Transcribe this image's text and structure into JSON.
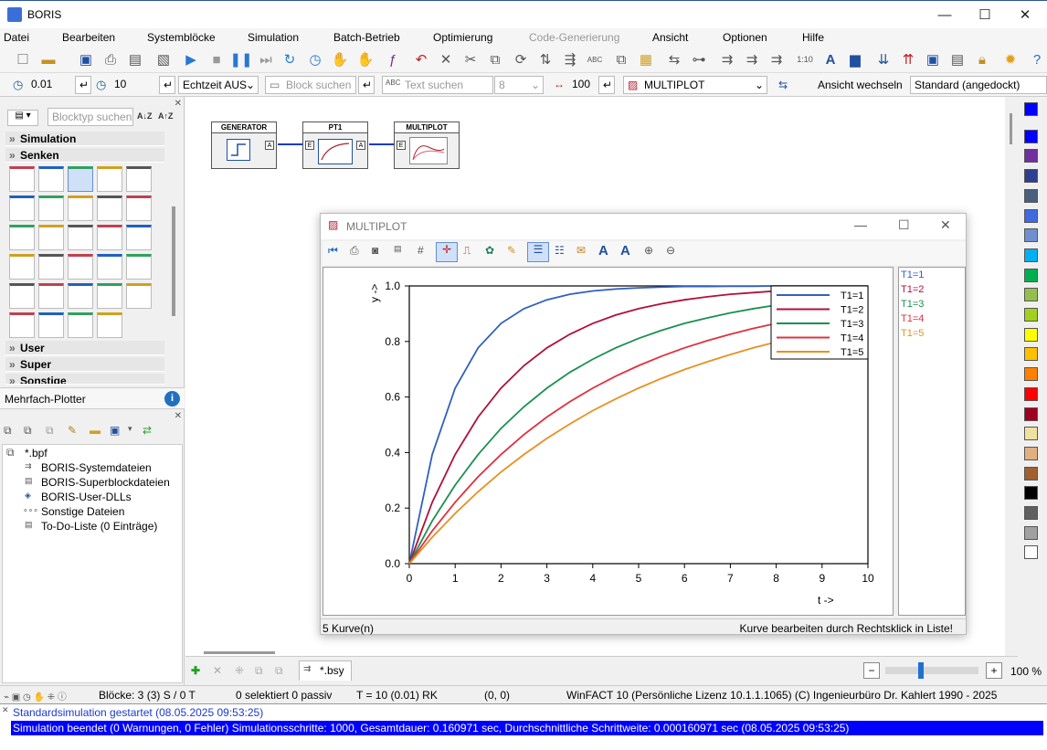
{
  "window": {
    "title": "BORIS",
    "minimize": "—",
    "maximize": "☐",
    "close": "✕"
  },
  "menu": [
    "Datei",
    "Bearbeiten",
    "Systemblöcke",
    "Simulation",
    "Batch-Betrieb",
    "Optimierung",
    "Code-Generierung",
    "Ansicht",
    "Optionen",
    "Hilfe"
  ],
  "toolbar2": {
    "step": "0.01",
    "end_time": "10",
    "realtime": "Echtzeit AUS",
    "block_search": "Block suchen",
    "text_search": "Text suchen",
    "font_size": "8",
    "zoom_val": "100",
    "target": "MULTIPLOT",
    "view_switch": "Ansicht wechseln",
    "layout": "Standard (angedockt)"
  },
  "left": {
    "search_placeholder": "Blocktyp suchen",
    "cats_top": [
      "Simulation",
      "Senken"
    ],
    "cats_bottom": [
      "User",
      "Super",
      "Sonstige"
    ],
    "selected_desc": "Mehrfach-Plotter",
    "tree_root": "*.bpf",
    "tree": [
      "BORIS-Systemdateien",
      "BORIS-Superblockdateien",
      "BORIS-User-DLLs",
      "Sonstige Dateien",
      "To-Do-Liste (0 Einträge)"
    ]
  },
  "diagram": {
    "blocks": [
      "GENERATOR",
      "PT1",
      "MULTIPLOT"
    ],
    "ports": {
      "out": "A",
      "in": "E"
    }
  },
  "plot": {
    "title": "MULTIPLOT",
    "status_left": "5 Kurve(n)",
    "status_right": "Kurve bearbeiten durch Rechtsklick in Liste!",
    "list": [
      "T1=1",
      "T1=2",
      "T1=3",
      "T1=4",
      "T1=5"
    ]
  },
  "chart_data": {
    "type": "line",
    "xlabel": "t ->",
    "ylabel": "y ->",
    "xlim": [
      0,
      10
    ],
    "ylim": [
      0,
      1
    ],
    "xticks": [
      "0",
      "1",
      "2",
      "3",
      "4",
      "5",
      "6",
      "7",
      "8",
      "9",
      "10"
    ],
    "yticks": [
      "0.0",
      "0.2",
      "0.4",
      "0.6",
      "0.8",
      "1.0"
    ],
    "x": [
      0,
      0.5,
      1,
      1.5,
      2,
      2.5,
      3,
      3.5,
      4,
      4.5,
      5,
      5.5,
      6,
      6.5,
      7,
      7.5,
      8,
      8.5,
      9,
      9.5,
      10
    ],
    "series": [
      {
        "name": "T1=1",
        "color": "#3060c0",
        "values": [
          0,
          0.393,
          0.632,
          0.777,
          0.865,
          0.918,
          0.95,
          0.97,
          0.982,
          0.989,
          0.993,
          0.996,
          0.998,
          0.998,
          0.999,
          0.999,
          1,
          1,
          1,
          1,
          1
        ]
      },
      {
        "name": "T1=2",
        "color": "#b0103a",
        "values": [
          0,
          0.221,
          0.393,
          0.528,
          0.632,
          0.713,
          0.777,
          0.826,
          0.865,
          0.895,
          0.918,
          0.936,
          0.95,
          0.961,
          0.97,
          0.976,
          0.982,
          0.986,
          0.989,
          0.991,
          0.993
        ]
      },
      {
        "name": "T1=3",
        "color": "#1a9050",
        "values": [
          0,
          0.154,
          0.283,
          0.393,
          0.487,
          0.565,
          0.632,
          0.689,
          0.736,
          0.777,
          0.811,
          0.84,
          0.865,
          0.885,
          0.903,
          0.918,
          0.931,
          0.941,
          0.95,
          0.958,
          0.964
        ]
      },
      {
        "name": "T1=4",
        "color": "#e03040",
        "values": [
          0,
          0.118,
          0.221,
          0.313,
          0.393,
          0.465,
          0.528,
          0.583,
          0.632,
          0.675,
          0.713,
          0.747,
          0.777,
          0.803,
          0.826,
          0.847,
          0.865,
          0.881,
          0.895,
          0.907,
          0.918
        ]
      },
      {
        "name": "T1=5",
        "color": "#e89020",
        "values": [
          0,
          0.095,
          0.181,
          0.259,
          0.33,
          0.393,
          0.451,
          0.503,
          0.551,
          0.593,
          0.632,
          0.667,
          0.699,
          0.727,
          0.753,
          0.777,
          0.798,
          0.817,
          0.835,
          0.85,
          0.865
        ]
      }
    ],
    "legend": "top-right",
    "grid": false
  },
  "tabs": {
    "file": "*.bsy",
    "zoom": "100 %"
  },
  "status": {
    "tools": "Blöcke: 3 (3) S / 0 T",
    "sel": "0 selektiert  0 passiv",
    "time": "T = 10  (0.01)  RK",
    "coords": "(0, 0)",
    "license": "WinFACT 10 (Persönliche Lizenz 10.1.1.1065)  (C) Ingenieurbüro Dr. Kahlert 1990 - 2025"
  },
  "log": [
    "Standardsimulation gestartet    (08.05.2025 09:53:25)",
    "Simulation beendet (0 Warnungen, 0 Fehler)    Simulationsschritte: 1000, Gesamtdauer:    0.160971 sec, Durchschnittliche Schrittweite: 0.000160971 sec   (08.05.2025 09:53:25)"
  ],
  "palette": [
    "#0000ff",
    "#0000ff",
    "#7030a0",
    "#2e3f8f",
    "#4a5f80",
    "#4169e1",
    "#6f8fd0",
    "#00b0f0",
    "#00b050",
    "#92c050",
    "#a0d020",
    "#ffff00",
    "#ffc000",
    "#ff8000",
    "#ff0000",
    "#a00020",
    "#f0e0a0",
    "#e0b080",
    "#a06030",
    "#000000",
    "#606060",
    "#a0a0a0",
    "#ffffff"
  ]
}
